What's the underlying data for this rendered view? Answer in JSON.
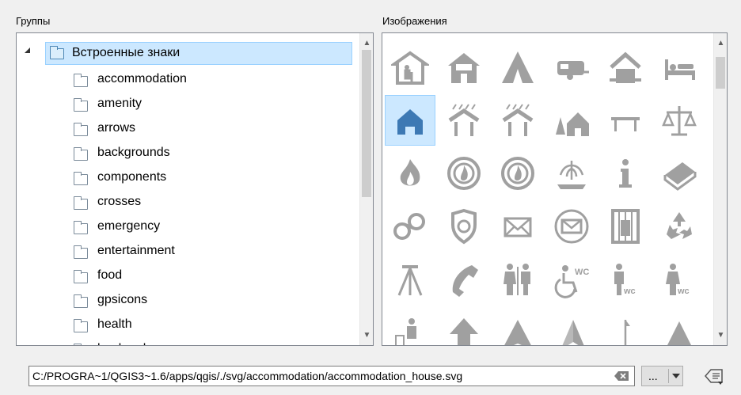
{
  "groups_label": "Группы",
  "images_label": "Изображения",
  "tree": {
    "root": "Встроенные знаки",
    "items": [
      "accommodation",
      "amenity",
      "arrows",
      "backgrounds",
      "components",
      "crosses",
      "emergency",
      "entertainment",
      "food",
      "gpsicons",
      "health",
      "landmark"
    ]
  },
  "path": {
    "value": "C:/PROGRA~1/QGIS3~1.6/apps/qgis/./svg/accommodation/accommodation_house.svg",
    "browse_label": "..."
  },
  "icons": [
    [
      "hostel-icon",
      "bed-and-breakfast-icon",
      "camping-tent-icon",
      "caravan-icon",
      "chalet-icon",
      "hotel-bed-icon"
    ],
    [
      "house-icon",
      "shelter-rain-icon",
      "shelter-icon",
      "youth-hostel-icon",
      "bench-icon",
      "court-scales-icon"
    ],
    [
      "fire-icon",
      "fire-station-icon",
      "fire-emblem-icon",
      "fountain-icon",
      "information-icon",
      "library-books-icon"
    ],
    [
      "police-handcuffs-icon",
      "police-badge-icon",
      "post-box-icon",
      "post-office-icon",
      "prison-icon",
      "recycling-icon"
    ],
    [
      "survey-tripod-icon",
      "telephone-icon",
      "toilets-icon",
      "toilets-disabled-icon",
      "toilets-men-icon",
      "toilets-women-icon"
    ],
    [
      "waste-bin-icon",
      "arrow-up-icon",
      "arrow-nav-icon",
      "arrow-nav-2-icon",
      "arrow-thin-icon",
      "arrow-pointer-icon"
    ]
  ],
  "colors": {
    "selection": "#cce8ff",
    "selection_border": "#99d1ff",
    "icon": "#a0a0a0",
    "selected_icon": "#3d79b4"
  }
}
